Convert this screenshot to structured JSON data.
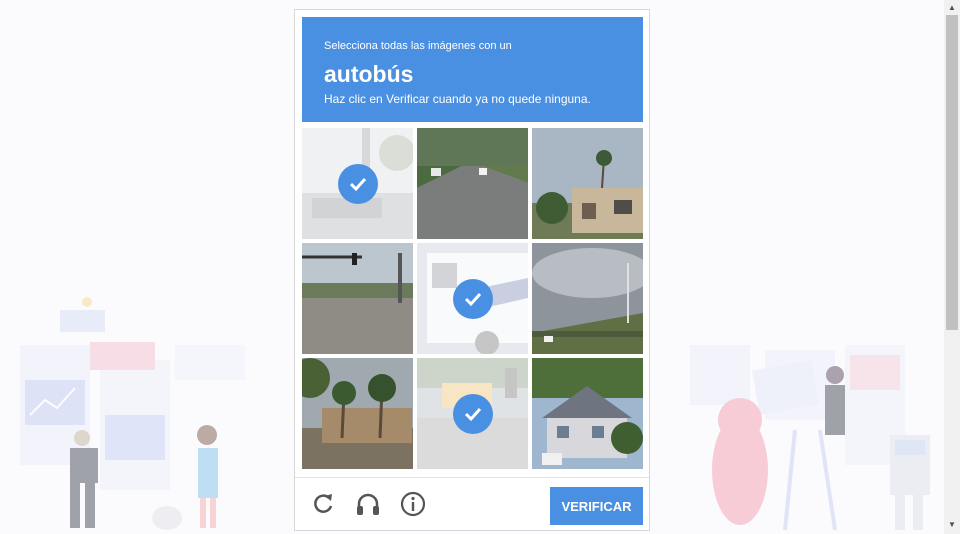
{
  "captcha": {
    "instruction": "Selecciona todas las imágenes con un",
    "target_word": "autobús",
    "hint": "Haz clic en Verificar cuando ya no quede ninguna.",
    "verify_label": "VERIFICAR",
    "tiles": [
      {
        "scene": "street-sign",
        "selected": true
      },
      {
        "scene": "road",
        "selected": false
      },
      {
        "scene": "house-palms",
        "selected": false
      },
      {
        "scene": "intersection",
        "selected": false
      },
      {
        "scene": "bus",
        "selected": true
      },
      {
        "scene": "field",
        "selected": false
      },
      {
        "scene": "palm-trees",
        "selected": false
      },
      {
        "scene": "school-bus",
        "selected": true
      },
      {
        "scene": "house",
        "selected": false
      }
    ]
  },
  "footer": {
    "reload_icon": "reload-icon",
    "audio_icon": "headphones-icon",
    "info_icon": "info-icon"
  },
  "colors": {
    "accent": "#4a90e2"
  }
}
